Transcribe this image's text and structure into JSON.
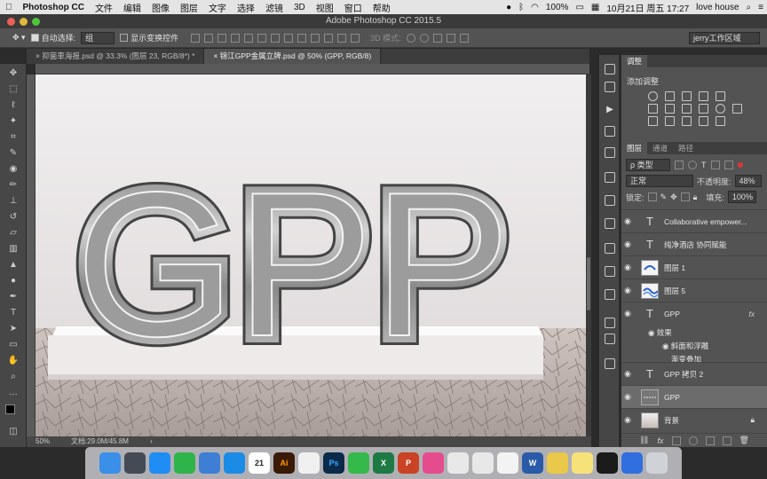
{
  "menubar": {
    "app": "Photoshop CC",
    "items": [
      "文件",
      "编辑",
      "图像",
      "图层",
      "文字",
      "选择",
      "滤镜",
      "3D",
      "视图",
      "窗口",
      "帮助"
    ],
    "battery": "100%",
    "datetime": "10月21日 周五 17:27",
    "user": "love house"
  },
  "window": {
    "title": "Adobe Photoshop CC 2015.5"
  },
  "options": {
    "auto_select_label": "自动选择:",
    "auto_select_value": "组",
    "show_transform_label": "显示变换控件",
    "mode_3d": "3D 模式:",
    "workspace": "jerry工作区域"
  },
  "doc_tabs": [
    {
      "label": "抑菌車海报.psd @ 33.3% (图层 23, RGB/8*) *",
      "active": false
    },
    {
      "label": "锦江GPP金属立牌.psd @ 50% (GPP, RGB/8)",
      "active": true
    }
  ],
  "canvas": {
    "text": "GPP"
  },
  "status": {
    "zoom": "50%",
    "doc": "文档:29.0M/45.8M"
  },
  "adjustments": {
    "title": "调整",
    "add": "添加调整"
  },
  "layers_panel": {
    "tabs": [
      "图层",
      "通道",
      "路径"
    ],
    "filter_kind": "ρ 类型",
    "blend_mode": "正常",
    "opacity_label": "不透明度:",
    "opacity": "48%",
    "lock_label": "锁定:",
    "fill_label": "填充:",
    "fill": "100%",
    "layers": [
      {
        "name": "Collaborative empower...",
        "kind": "text"
      },
      {
        "name": "纯净酒店 协同赋能",
        "kind": "text"
      },
      {
        "name": "图层 1",
        "kind": "image"
      },
      {
        "name": "图层 5",
        "kind": "image"
      },
      {
        "name": "GPP",
        "kind": "text",
        "fx": "fx"
      },
      {
        "name": "GPP 拷贝 2",
        "kind": "text"
      },
      {
        "name": "GPP",
        "kind": "shape",
        "selected": true
      },
      {
        "name": "背景",
        "kind": "image",
        "locked": true
      }
    ],
    "effects_label": "效果",
    "effects": [
      "斜面和浮雕",
      "渐变叠加"
    ]
  },
  "colors": {
    "accent": "#2d5fd1",
    "panel": "#535353",
    "bg": "#2b2b2b"
  },
  "dock": [
    {
      "icon": "finder-icon",
      "color": "#3a8fe8"
    },
    {
      "icon": "launchpad-icon",
      "color": "#444b55"
    },
    {
      "icon": "app-store-icon",
      "color": "#1f8df3"
    },
    {
      "icon": "facetime-icon",
      "color": "#2fb44b"
    },
    {
      "icon": "qq-icon",
      "color": "#3e7ed4"
    },
    {
      "icon": "safari-icon",
      "color": "#1a8ce6"
    },
    {
      "icon": "calendar-icon",
      "color": "#ffffff",
      "text": "21"
    },
    {
      "icon": "illustrator-icon",
      "color": "#3a1a05",
      "text": "Ai"
    },
    {
      "icon": "qq-penguin-icon",
      "color": "#f0f0f0"
    },
    {
      "icon": "photoshop-icon",
      "color": "#0b2a4a",
      "text": "Ps"
    },
    {
      "icon": "wechat-icon",
      "color": "#35b94b"
    },
    {
      "icon": "excel-icon",
      "color": "#1e7a44",
      "text": "X"
    },
    {
      "icon": "powerpoint-icon",
      "color": "#c94324",
      "text": "P"
    },
    {
      "icon": "itunes-icon",
      "color": "#e54c8e"
    },
    {
      "icon": "acrobat-icon",
      "color": "#e8e8e8"
    },
    {
      "icon": "pdf-icon",
      "color": "#e8e8e8"
    },
    {
      "icon": "photos-icon",
      "color": "#f3f3f3"
    },
    {
      "icon": "word-icon",
      "color": "#2a5aa8",
      "text": "W"
    },
    {
      "icon": "sticky-app-icon",
      "color": "#e9c84a"
    },
    {
      "icon": "notes-icon",
      "color": "#f7e27a"
    },
    {
      "icon": "quicktime-icon",
      "color": "#1b1b1b"
    },
    {
      "icon": "baidu-icon",
      "color": "#2f6fe0"
    },
    {
      "icon": "trash-icon",
      "color": "#cfd3d8"
    }
  ]
}
